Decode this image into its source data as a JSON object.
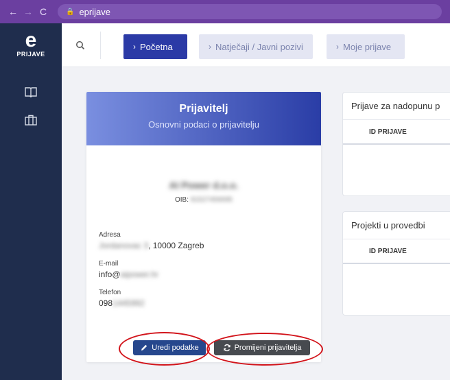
{
  "browser": {
    "back": "←",
    "forward": "→",
    "reload": "C",
    "url": "eprijave"
  },
  "sidebar": {
    "logo_letter": "e",
    "logo_text": "PRIJAVE",
    "icons": [
      "book-icon",
      "briefcase-icon"
    ]
  },
  "header": {
    "tabs": [
      {
        "label": "Početna",
        "active": true
      },
      {
        "label": "Natječaji / Javni pozivi",
        "active": false
      },
      {
        "label": "Moje prijave",
        "active": false
      }
    ]
  },
  "applicant": {
    "title": "Prijavitelj",
    "subtitle": "Osnovni podaci o prijavitelju",
    "company": "AI Power d.o.o.",
    "oib_label": "OIB:",
    "oib_value": "91527456695",
    "address_label": "Adresa",
    "address_hidden": "Jordanovac 3",
    "address_visible": ", 10000 Zagreb",
    "email_label": "E-mail",
    "email_visible": "info@",
    "email_hidden": "aipower.hr",
    "phone_label": "Telefon",
    "phone_visible": "098",
    "phone_hidden": " 1445992",
    "edit_button": "Uredi podatke",
    "change_button": "Promijeni prijavitelja"
  },
  "panels": [
    {
      "title": "Prijave za nadopunu p",
      "column": "ID PRIJAVE"
    },
    {
      "title": "Projekti u provedbi",
      "column": "ID PRIJAVE"
    }
  ],
  "colors": {
    "browser_bar": "#6b3fa0",
    "sidebar": "#1f2d4d",
    "accent": "#2b3aa6",
    "annotation": "#d2141b"
  }
}
